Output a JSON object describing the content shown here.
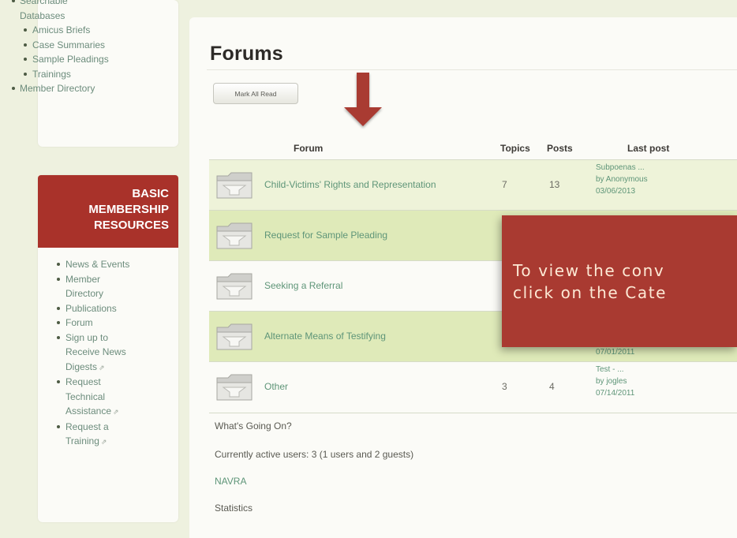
{
  "sidebar_top": {
    "items": [
      {
        "level": 1,
        "label": "Searchable",
        "cont": "Databases"
      },
      {
        "level": 2,
        "label": "Amicus Briefs"
      },
      {
        "level": 2,
        "label": "Case Summaries"
      },
      {
        "level": 2,
        "label": "Sample Pleadings"
      },
      {
        "level": 2,
        "label": "Trainings"
      },
      {
        "level": 1,
        "label": "Member Directory"
      }
    ]
  },
  "basic_banner": {
    "line1": "BASIC",
    "line2": "MEMBERSHIP",
    "line3": "RESOURCES",
    "color": "#a9322a"
  },
  "sidebar_basic": {
    "items": [
      {
        "label": "News & Events"
      },
      {
        "label": "Member",
        "cont": "Directory"
      },
      {
        "label": "Publications"
      },
      {
        "label": "Forum"
      },
      {
        "label": "Sign up to",
        "cont1": "Receive News",
        "cont2": "Digests"
      },
      {
        "label": "Request",
        "cont1": "Technical",
        "cont2": "Assistance"
      },
      {
        "label": "Request a",
        "cont": "Training"
      }
    ]
  },
  "main": {
    "title": "Forums",
    "mark_all_read": "Mark All Read",
    "headers": {
      "forum": "Forum",
      "topics": "Topics",
      "posts": "Posts",
      "last_post": "Last post"
    },
    "rows": [
      {
        "name": "Child-Victims' Rights and Representation",
        "topics": "7",
        "posts": "13",
        "last_title": "Subpoenas ...",
        "last_by": "by Anonymous",
        "last_date": "03/06/2013"
      },
      {
        "name": "Request for Sample Pleading"
      },
      {
        "name": "Seeking a Referral"
      },
      {
        "name": "Alternate Means of Testifying",
        "last_date": "07/01/2011"
      },
      {
        "name": "Other",
        "topics": "3",
        "posts": "4",
        "last_title": "Test - ...",
        "last_by": "by jogles",
        "last_date": "07/14/2011"
      }
    ],
    "whats_going_on": "What's Going On?",
    "active_users": "Currently active users: 3 (1 users and 2 guests)",
    "navra": "NAVRA",
    "statistics": "Statistics"
  },
  "callout": {
    "line1": "To view the conv",
    "line2": "click on the Cate",
    "color": "#a93a31"
  },
  "colors": {
    "page_bg": "#eef1df",
    "row_green": "#dfeab9",
    "link": "#5e9578"
  }
}
